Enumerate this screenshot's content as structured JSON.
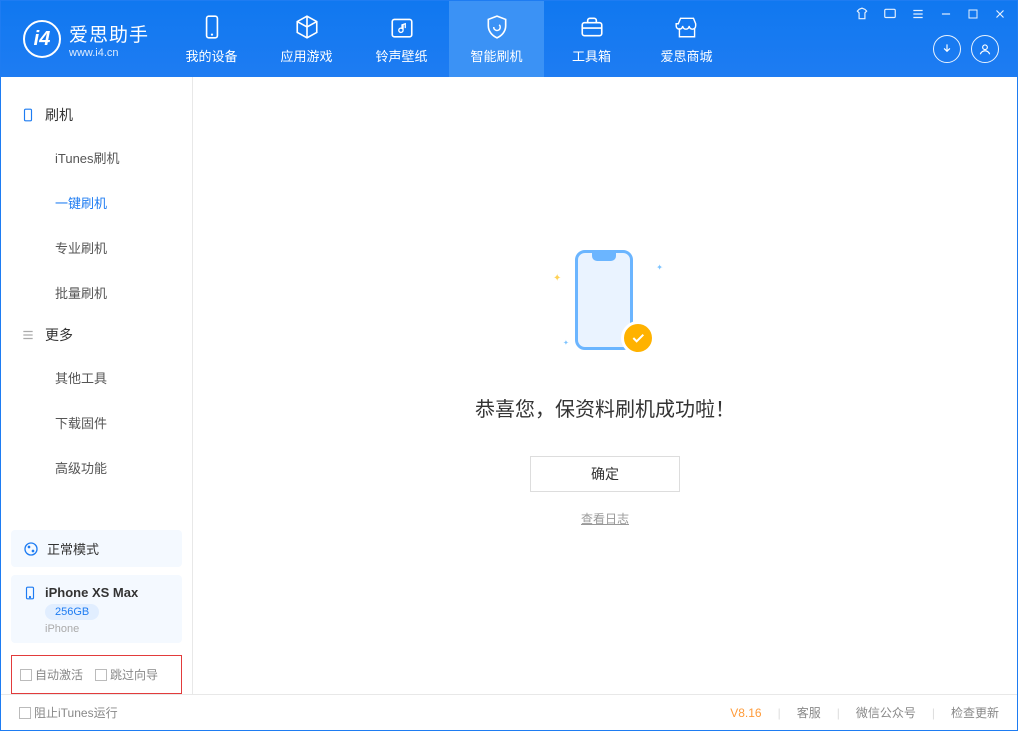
{
  "app": {
    "name": "爱思助手",
    "url": "www.i4.cn"
  },
  "nav": {
    "items": [
      {
        "label": "我的设备"
      },
      {
        "label": "应用游戏"
      },
      {
        "label": "铃声壁纸"
      },
      {
        "label": "智能刷机"
      },
      {
        "label": "工具箱"
      },
      {
        "label": "爱思商城"
      }
    ]
  },
  "sidebar": {
    "group1": {
      "title": "刷机",
      "items": [
        "iTunes刷机",
        "一键刷机",
        "专业刷机",
        "批量刷机"
      ]
    },
    "group2": {
      "title": "更多",
      "items": [
        "其他工具",
        "下载固件",
        "高级功能"
      ]
    },
    "status": {
      "label": "正常模式"
    },
    "device": {
      "name": "iPhone XS Max",
      "storage": "256GB",
      "type": "iPhone"
    },
    "checks": {
      "auto_activate": "自动激活",
      "skip_guide": "跳过向导"
    }
  },
  "main": {
    "success_text": "恭喜您，保资料刷机成功啦！",
    "confirm": "确定",
    "view_log": "查看日志"
  },
  "statusbar": {
    "block_itunes": "阻止iTunes运行",
    "version": "V8.16",
    "support": "客服",
    "wechat": "微信公众号",
    "update": "检查更新"
  }
}
